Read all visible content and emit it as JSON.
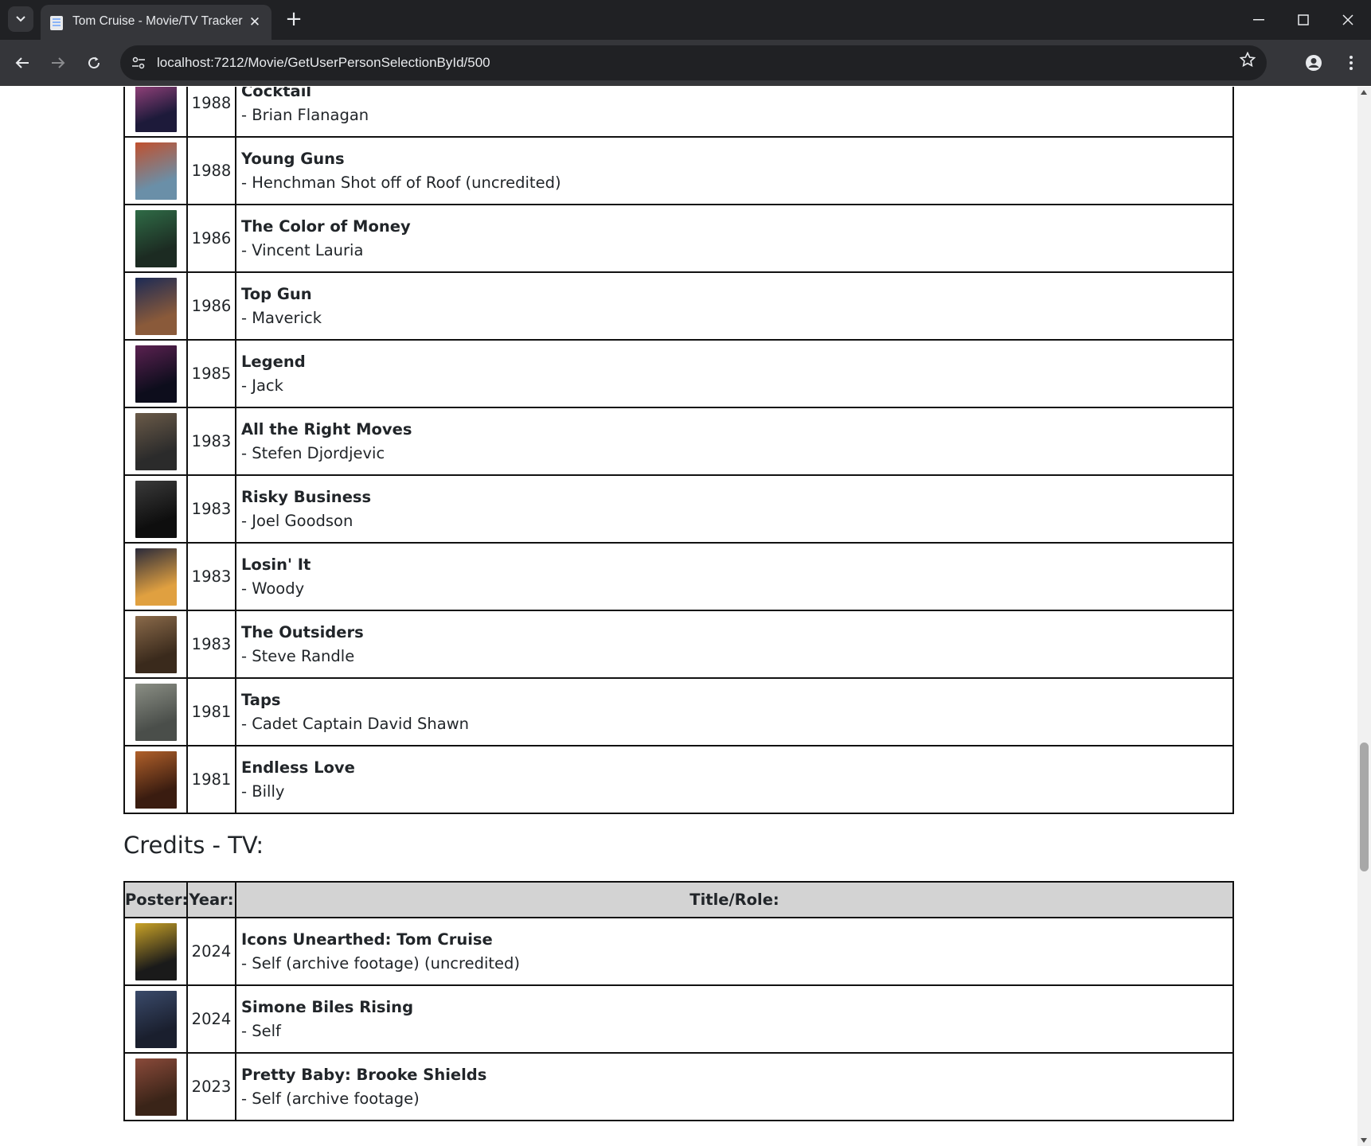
{
  "browser": {
    "tab_title": "Tom Cruise - Movie/TV Tracker",
    "url": "localhost:7212/Movie/GetUserPersonSelectionById/500",
    "new_tab": "+",
    "close_tab": "✕",
    "minimize": "—",
    "maximize": "☐",
    "close_window": "✕"
  },
  "movie_rows": [
    {
      "year": "1988",
      "title": "Cocktail",
      "role": "- Brian Flanagan",
      "poster_colors": [
        "#1d1a3a",
        "#b14b8a"
      ]
    },
    {
      "year": "1988",
      "title": "Young Guns",
      "role": "- Henchman Shot off of Roof (uncredited)",
      "poster_colors": [
        "#6a8fa8",
        "#c0502e"
      ]
    },
    {
      "year": "1986",
      "title": "The Color of Money",
      "role": "- Vincent Lauria",
      "poster_colors": [
        "#1c2b22",
        "#2f6b46"
      ]
    },
    {
      "year": "1986",
      "title": "Top Gun",
      "role": "- Maverick",
      "poster_colors": [
        "#8a5a3a",
        "#1c2a55"
      ]
    },
    {
      "year": "1985",
      "title": "Legend",
      "role": "- Jack",
      "poster_colors": [
        "#0d0d1c",
        "#5a2150"
      ]
    },
    {
      "year": "1983",
      "title": "All the Right Moves",
      "role": "- Stefen Djordjevic",
      "poster_colors": [
        "#2b2b2b",
        "#6a5a48"
      ]
    },
    {
      "year": "1983",
      "title": "Risky Business",
      "role": "- Joel Goodson",
      "poster_colors": [
        "#0e0e0e",
        "#3a3a3a"
      ]
    },
    {
      "year": "1983",
      "title": "Losin' It",
      "role": "- Woody",
      "poster_colors": [
        "#e0a040",
        "#2a2a3a"
      ]
    },
    {
      "year": "1983",
      "title": "The Outsiders",
      "role": "- Steve Randle",
      "poster_colors": [
        "#3a2a1c",
        "#8a6a4a"
      ]
    },
    {
      "year": "1981",
      "title": "Taps",
      "role": "- Cadet Captain David Shawn",
      "poster_colors": [
        "#4a4e4a",
        "#8a8e84"
      ]
    },
    {
      "year": "1981",
      "title": "Endless Love",
      "role": "- Billy",
      "poster_colors": [
        "#3a1c10",
        "#b0602a"
      ]
    }
  ],
  "tv_section": {
    "heading": "Credits - TV:",
    "headers": {
      "poster": "Poster:",
      "year": "Year:",
      "title": "Title/Role:"
    },
    "rows": [
      {
        "year": "2024",
        "title": "Icons Unearthed: Tom Cruise",
        "role": "- Self (archive footage) (uncredited)",
        "poster_colors": [
          "#1a1a1a",
          "#c9a227"
        ]
      },
      {
        "year": "2024",
        "title": "Simone Biles Rising",
        "role": "- Self",
        "poster_colors": [
          "#1a1f2e",
          "#3a4a6a"
        ]
      },
      {
        "year": "2023",
        "title": "Pretty Baby: Brooke Shields",
        "role": "- Self (archive footage)",
        "poster_colors": [
          "#3a2418",
          "#8a4a3a"
        ]
      }
    ]
  }
}
